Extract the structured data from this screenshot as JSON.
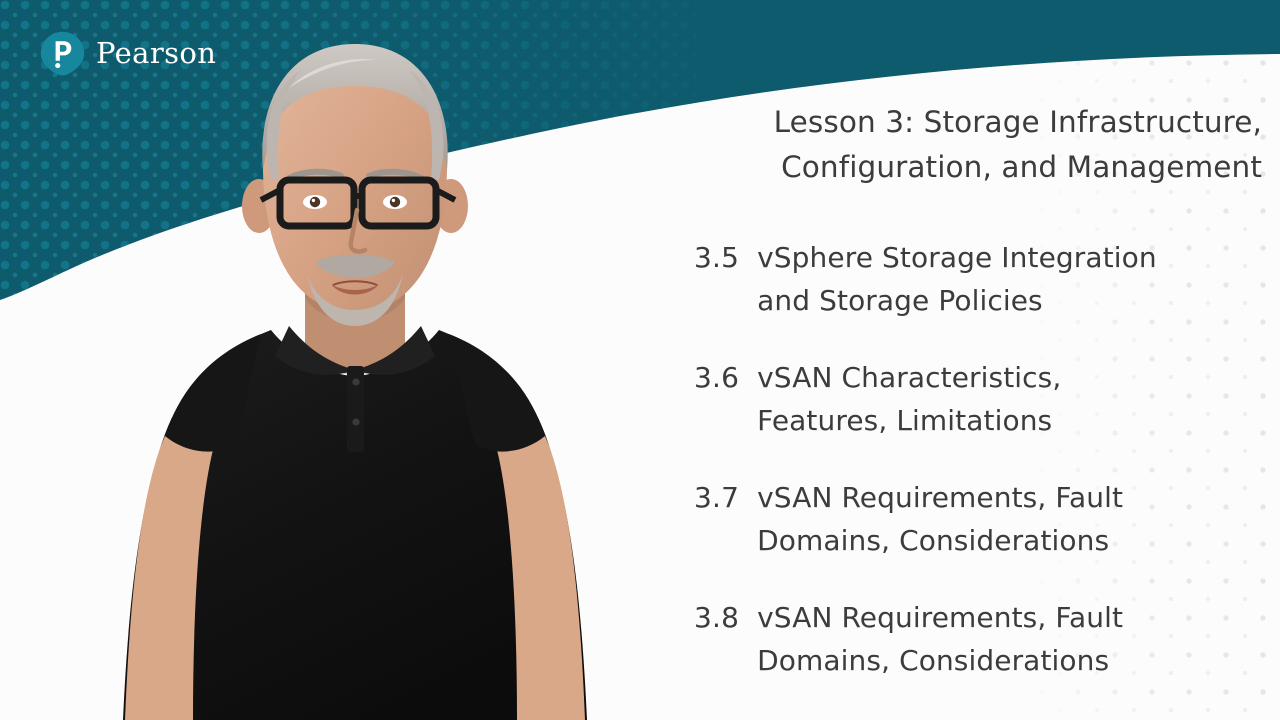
{
  "brand": {
    "name": "Pearson",
    "logo_icon": "pearson-p-interrobang-icon",
    "teal": "#0d5b6c",
    "logo_mark_teal": "#17879d"
  },
  "slide": {
    "title": {
      "line1": "Lesson 3: Storage Infrastructure,",
      "line2": "Configuration, and Management"
    },
    "topics": [
      {
        "number": "3.5",
        "line1": "vSphere Storage Integration",
        "line2": "and Storage Policies"
      },
      {
        "number": "3.6",
        "line1": "vSAN Characteristics,",
        "line2": "Features, Limitations"
      },
      {
        "number": "3.7",
        "line1": "vSAN Requirements, Fault",
        "line2": "Domains, Considerations"
      },
      {
        "number": "3.8",
        "line1": "vSAN Requirements, Fault",
        "line2": "Domains, Considerations"
      }
    ],
    "text_color": "#3c3c3c"
  },
  "presenter": {
    "description": "instructor-video-frame",
    "shirt_color": "#151515",
    "hair_color": "#b9b3ae",
    "glasses_color": "#1b1b1b"
  }
}
